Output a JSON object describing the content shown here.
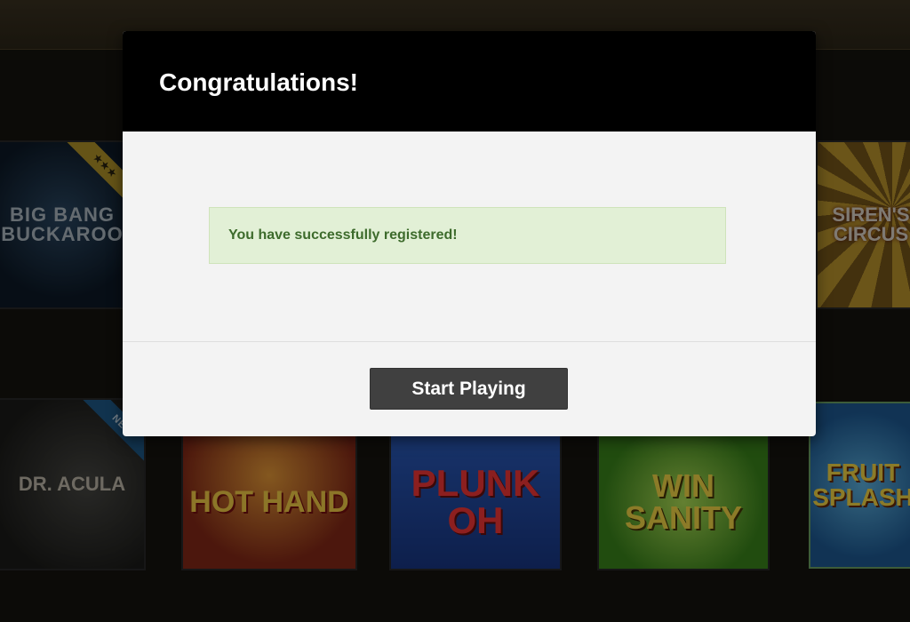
{
  "modal": {
    "title": "Congratulations!",
    "success_message": "You have successfully registered!",
    "start_button_label": "Start Playing",
    "colors": {
      "header_bg": "#000000",
      "body_bg": "#f3f3f3",
      "alert_bg": "#e2f0d6",
      "alert_text": "#3d6b2c",
      "button_bg": "#404040"
    }
  },
  "background_games": [
    {
      "title": "BIG BANG\nBUCKAROO",
      "badge": "★★★"
    },
    {
      "title": "SIREN'S\nCIRCUS",
      "badge": ""
    },
    {
      "title": "DR. ACULA",
      "badge": "NEW"
    },
    {
      "title": "HOT HAND",
      "badge": ""
    },
    {
      "title": "PLUNK\nOH",
      "badge": ""
    },
    {
      "title": "WIN\nSANITY",
      "badge": ""
    },
    {
      "title": "FRUIT\nSPLASH",
      "badge": ""
    }
  ]
}
